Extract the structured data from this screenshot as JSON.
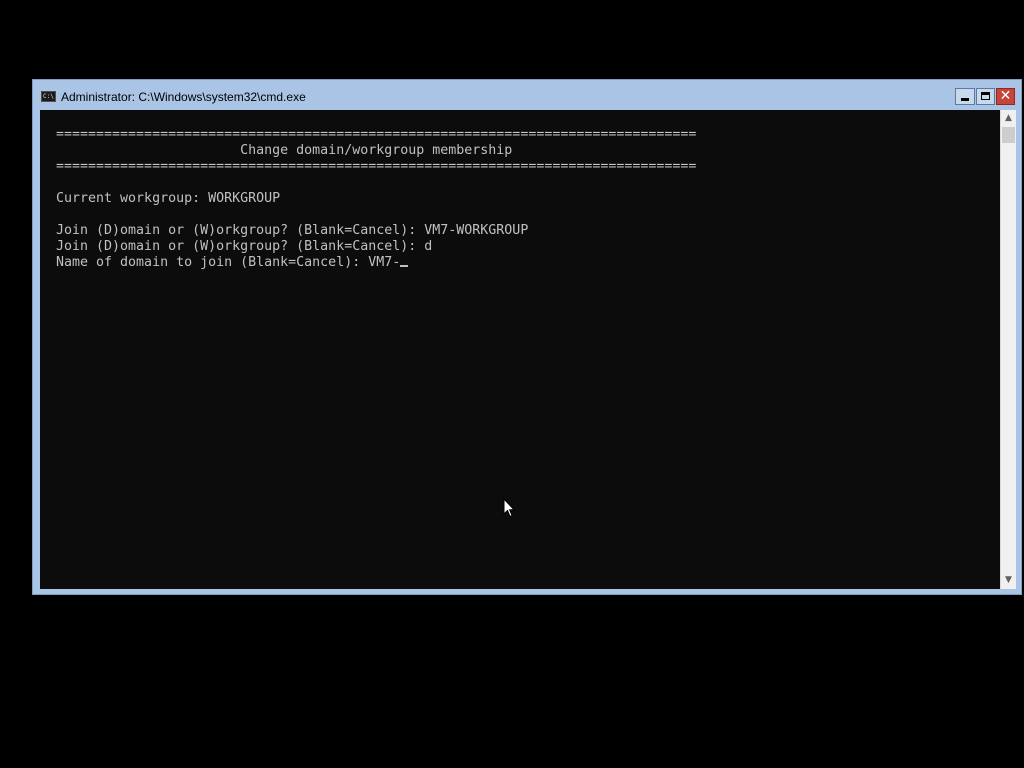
{
  "window": {
    "title": "Administrator: C:\\Windows\\system32\\cmd.exe",
    "icon": "console-icon",
    "icon_text": "C:\\",
    "controls": {
      "minimize": "minimize-icon",
      "maximize": "maximize-icon",
      "close": "close-icon"
    }
  },
  "console": {
    "lines": [
      "================================================================================",
      "                       Change domain/workgroup membership",
      "================================================================================",
      "",
      "Current workgroup: WORKGROUP",
      "",
      "Join (D)omain or (W)orkgroup? (Blank=Cancel): VM7-WORKGROUP",
      "Join (D)omain or (W)orkgroup? (Blank=Cancel): d",
      "Name of domain to join (Blank=Cancel): VM7-"
    ],
    "foreground_color": "#c0c0c0",
    "background_color": "#0c0c0c"
  },
  "scrollbar": {
    "up_icon": "scroll-up-arrow-icon",
    "down_icon": "scroll-down-arrow-icon"
  },
  "theme": {
    "frame_color": "#a9c4e4",
    "close_button_color": "#c7443a"
  }
}
